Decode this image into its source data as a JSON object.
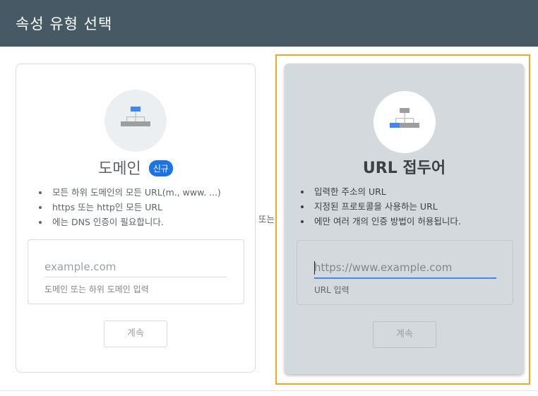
{
  "header": {
    "title": "속성 유형 선택"
  },
  "separator": {
    "or_label": "또는"
  },
  "domain_card": {
    "title": "도메인",
    "badge": "신규",
    "icon": "sitemap-icon",
    "bullets": [
      "모든 하위 도메인의 모든 URL(m., www. ...)",
      "https 또는 http인 모든 URL",
      "에는 DNS 인증이 필요합니다."
    ],
    "input": {
      "placeholder": "example.com",
      "value": ""
    },
    "helper": "도메인 또는 하위 도메인 입력",
    "button": "계속"
  },
  "url_card": {
    "title": "URL 접두어",
    "icon": "sitemap-icon",
    "selected": true,
    "bullets": [
      "입력한 주소의 URL",
      "지정된 프로토콜을 사용하는 URL",
      "에만 여러 개의 인증 방법이 허용됩니다."
    ],
    "input": {
      "placeholder": "https://www.example.com",
      "value": ""
    },
    "helper": "URL 입력",
    "button": "계속"
  },
  "colors": {
    "header_bg": "#465964",
    "selection_outline": "#f5a623",
    "selected_card_bg": "#d3d9dd",
    "accent_blue": "#4285f4",
    "badge_blue": "#1a73e8"
  }
}
